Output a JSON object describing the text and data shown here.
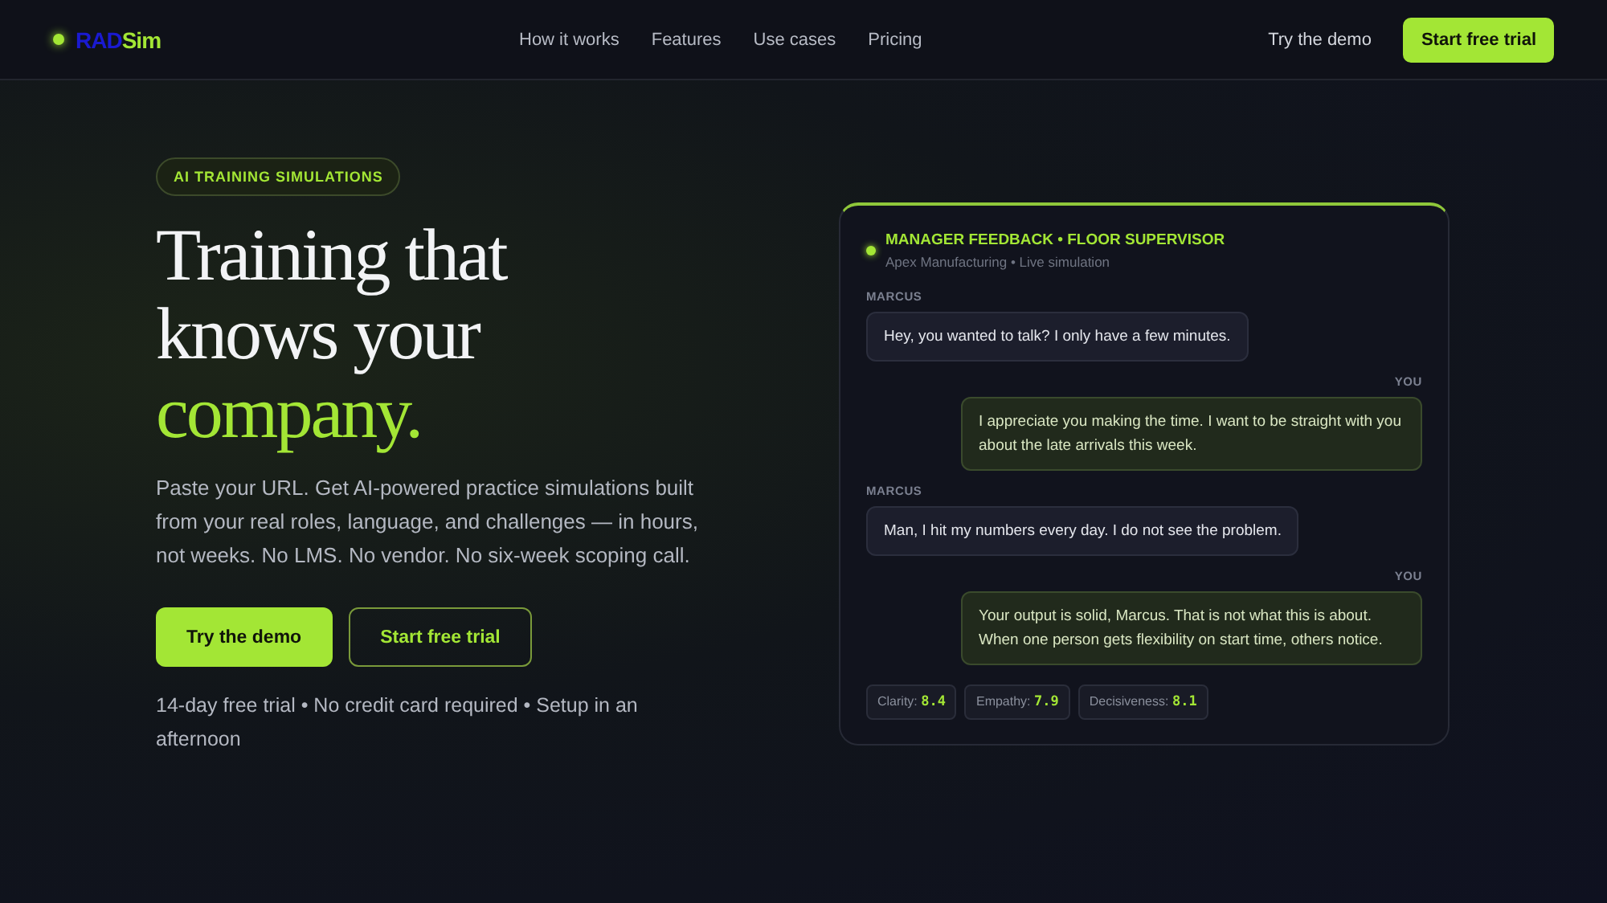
{
  "nav": {
    "logo": {
      "primary": "RAD",
      "accent": "Sim"
    },
    "links": [
      {
        "label": "How it works"
      },
      {
        "label": "Features"
      },
      {
        "label": "Use cases"
      },
      {
        "label": "Pricing"
      }
    ],
    "demo_link": "Try the demo",
    "cta": "Start free trial"
  },
  "hero": {
    "badge": "AI TRAINING SIMULATIONS",
    "headline": "Training that knows your",
    "headline_accent": "company.",
    "description": "Paste your URL. Get AI-powered practice simulations built from your real roles, language, and challenges — in hours, not weeks. No LMS. No vendor. No six-week scoping call.",
    "buttons": [
      {
        "label": "Try the demo",
        "kind": "primary"
      },
      {
        "label": "Start free trial",
        "kind": "outline"
      }
    ],
    "note": "14-day free trial • No credit card required • Setup in an afternoon"
  },
  "simulation": {
    "title": "MANAGER FEEDBACK • FLOOR SUPERVISOR",
    "subtitle": "Apex Manufacturing • Live simulation",
    "messages": [
      {
        "speaker": "MARCUS",
        "kind": "them",
        "text": "Hey, you wanted to talk? I only have a few minutes."
      },
      {
        "speaker": "YOU",
        "kind": "you",
        "text": "I appreciate you making the time. I want to be straight with you about the late arrivals this week."
      },
      {
        "speaker": "MARCUS",
        "kind": "them",
        "text": "Man, I hit my numbers every day. I do not see the problem."
      },
      {
        "speaker": "YOU",
        "kind": "you",
        "text": "Your output is solid, Marcus. That is not what this is about. When one person gets flexibility on start time, others notice."
      }
    ],
    "scores": [
      {
        "label": "Clarity:",
        "value": "8.4"
      },
      {
        "label": "Empathy:",
        "value": "7.9"
      },
      {
        "label": "Decisiveness:",
        "value": "8.1"
      }
    ]
  }
}
